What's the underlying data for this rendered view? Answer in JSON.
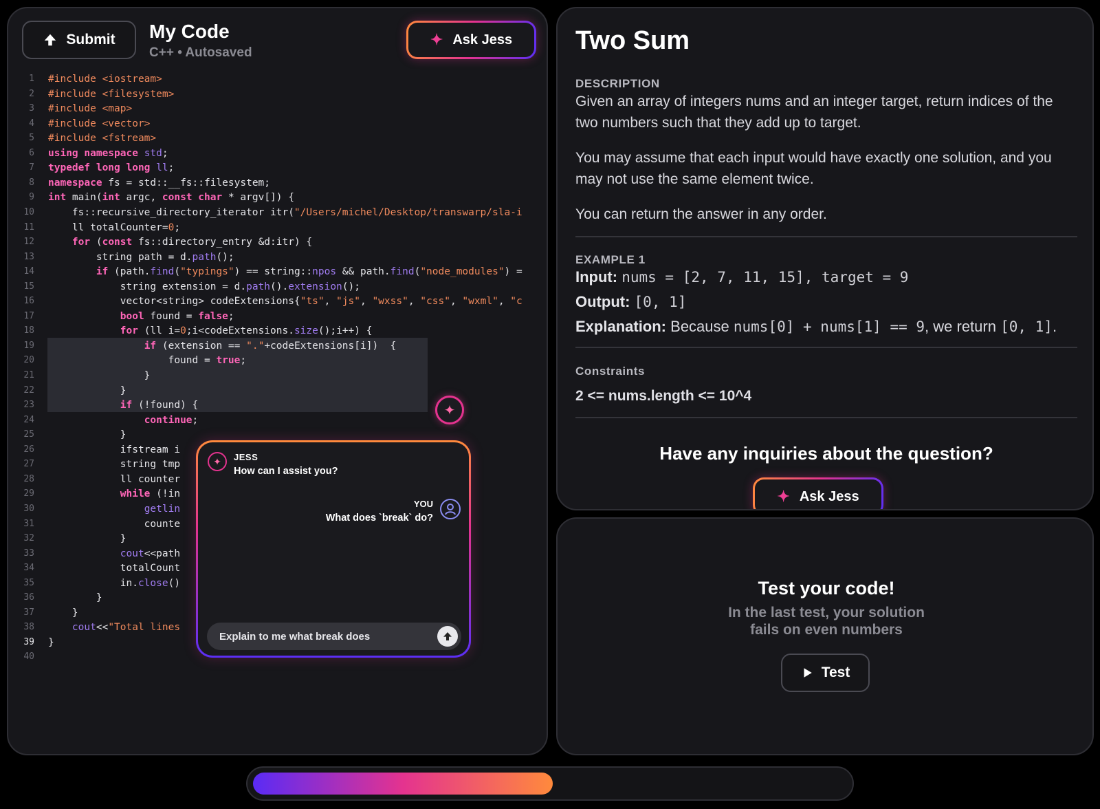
{
  "editor": {
    "submit_label": "Submit",
    "title": "My Code",
    "subtitle": "C++ • Autosaved",
    "ask_label": "Ask Jess",
    "active_line": 39,
    "lines": [
      [
        [
          "pp",
          "#include <iostream>"
        ]
      ],
      [
        [
          "pp",
          "#include <filesystem>"
        ]
      ],
      [
        [
          "pp",
          "#include <map>"
        ]
      ],
      [
        [
          "pp",
          "#include <vector>"
        ]
      ],
      [
        [
          "pp",
          "#include <fstream>"
        ]
      ],
      [
        [
          "kw",
          "using"
        ],
        [
          "op",
          " "
        ],
        [
          "kw",
          "namespace"
        ],
        [
          "op",
          " "
        ],
        [
          "id",
          "std"
        ],
        [
          "op",
          ";"
        ]
      ],
      [
        [
          "kw",
          "typedef"
        ],
        [
          "op",
          " "
        ],
        [
          "kw",
          "long long"
        ],
        [
          "op",
          " "
        ],
        [
          "id",
          "ll"
        ],
        [
          "op",
          ";"
        ]
      ],
      [
        [
          "kw",
          "namespace"
        ],
        [
          "op",
          " fs = std::__fs::filesystem;"
        ]
      ],
      [
        [
          "kw",
          "int"
        ],
        [
          "op",
          " main("
        ],
        [
          "kw",
          "int"
        ],
        [
          "op",
          " argc, "
        ],
        [
          "kw",
          "const char"
        ],
        [
          "op",
          " * argv[]) {"
        ]
      ],
      [
        [
          "op",
          "    fs::recursive_directory_iterator itr("
        ],
        [
          "st",
          "\"/Users/michel/Desktop/transwarp/sla-i"
        ]
      ],
      [
        [
          "op",
          "    ll totalCounter="
        ],
        [
          "nm",
          "0"
        ],
        [
          "op",
          ";"
        ]
      ],
      [
        [
          "op",
          "    "
        ],
        [
          "kw",
          "for"
        ],
        [
          "op",
          " ("
        ],
        [
          "kw",
          "const"
        ],
        [
          "op",
          " fs::directory_entry &d:itr) {"
        ]
      ],
      [
        [
          "op",
          "        string path = d."
        ],
        [
          "fn",
          "path"
        ],
        [
          "op",
          "();"
        ]
      ],
      [
        [
          "op",
          "        "
        ],
        [
          "kw",
          "if"
        ],
        [
          "op",
          " (path."
        ],
        [
          "fn",
          "find"
        ],
        [
          "op",
          "("
        ],
        [
          "st",
          "\"typings\""
        ],
        [
          "op",
          ") == string::"
        ],
        [
          "fn",
          "npos"
        ],
        [
          "op",
          " && path."
        ],
        [
          "fn",
          "find"
        ],
        [
          "op",
          "("
        ],
        [
          "st",
          "\"node_modules\""
        ],
        [
          "op",
          ") ="
        ]
      ],
      [
        [
          "op",
          "            string extension = d."
        ],
        [
          "fn",
          "path"
        ],
        [
          "op",
          "()."
        ],
        [
          "fn",
          "extension"
        ],
        [
          "op",
          "();"
        ]
      ],
      [
        [
          "op",
          "            vector<string> codeExtensions{"
        ],
        [
          "st",
          "\"ts\""
        ],
        [
          "op",
          ", "
        ],
        [
          "st",
          "\"js\""
        ],
        [
          "op",
          ", "
        ],
        [
          "st",
          "\"wxss\""
        ],
        [
          "op",
          ", "
        ],
        [
          "st",
          "\"css\""
        ],
        [
          "op",
          ", "
        ],
        [
          "st",
          "\"wxml\""
        ],
        [
          "op",
          ", "
        ],
        [
          "st",
          "\"c"
        ]
      ],
      [
        [
          "op",
          "            "
        ],
        [
          "kw",
          "bool"
        ],
        [
          "op",
          " found = "
        ],
        [
          "kw",
          "false"
        ],
        [
          "op",
          ";"
        ]
      ],
      [
        [
          "op",
          "            "
        ],
        [
          "kw",
          "for"
        ],
        [
          "op",
          " (ll i="
        ],
        [
          "nm",
          "0"
        ],
        [
          "op",
          ";i<codeExtensions."
        ],
        [
          "fn",
          "size"
        ],
        [
          "op",
          "();i++) {"
        ]
      ],
      [
        [
          "op",
          "                "
        ],
        [
          "kw",
          "if"
        ],
        [
          "op",
          " (extension == "
        ],
        [
          "st",
          "\".\""
        ],
        [
          "op",
          "+codeExtensions[i])  {"
        ]
      ],
      [
        [
          "op",
          "                    found = "
        ],
        [
          "kw",
          "true"
        ],
        [
          "op",
          ";"
        ]
      ],
      [
        [
          "op",
          "                }"
        ]
      ],
      [
        [
          "op",
          "            }"
        ]
      ],
      [
        [
          "op",
          "            "
        ],
        [
          "kw",
          "if"
        ],
        [
          "op",
          " (!found) {"
        ]
      ],
      [
        [
          "op",
          "                "
        ],
        [
          "kw",
          "continue"
        ],
        [
          "op",
          ";"
        ]
      ],
      [
        [
          "op",
          "            }"
        ]
      ],
      [
        [
          "op",
          "            ifstream i"
        ]
      ],
      [
        [
          "op",
          "            string tmp"
        ]
      ],
      [
        [
          "op",
          "            ll counter"
        ]
      ],
      [
        [
          "op",
          "            "
        ],
        [
          "kw",
          "while"
        ],
        [
          "op",
          " (!in"
        ]
      ],
      [
        [
          "op",
          "                "
        ],
        [
          "fn",
          "getlin"
        ]
      ],
      [
        [
          "op",
          "                counte"
        ]
      ],
      [
        [
          "op",
          "            }"
        ]
      ],
      [
        [
          "op",
          "            "
        ],
        [
          "fn",
          "cout"
        ],
        [
          "op",
          "<<path"
        ]
      ],
      [
        [
          "op",
          "            totalCount"
        ]
      ],
      [
        [
          "op",
          "            in."
        ],
        [
          "fn",
          "close"
        ],
        [
          "op",
          "()"
        ]
      ],
      [
        [
          "op",
          "        }"
        ]
      ],
      [
        [
          "op",
          "    }"
        ]
      ],
      [
        [
          "op",
          "    "
        ],
        [
          "fn",
          "cout"
        ],
        [
          "op",
          "<<"
        ],
        [
          "st",
          "\"Total lines"
        ]
      ],
      [
        [
          "op",
          "}"
        ]
      ],
      [
        [
          "op",
          ""
        ]
      ]
    ]
  },
  "chat": {
    "assistant_name": "JESS",
    "assistant_msg": "How can I assist you?",
    "user_name": "YOU",
    "user_msg": "What does `break` do?",
    "input_value": "Explain to me what break does"
  },
  "problem": {
    "title": "Two Sum",
    "description_label": "DESCRIPTION",
    "para1": "Given an array of integers nums and an integer target, return indices of the two numbers such that they add up to target.",
    "para2": "You may assume that each input would have exactly one solution, and you may not use the same element twice.",
    "para3": "You can return the answer in any order.",
    "example_label": "EXAMPLE 1",
    "input_label": "Input:",
    "input_value": "nums = [2, 7, 11, 15], target = 9",
    "output_label": "Output:",
    "output_value": "[0, 1]",
    "explanation_label": "Explanation:",
    "explanation_pre": "Because ",
    "explanation_code1": "nums[0] + nums[1] == 9",
    "explanation_mid": ", we return ",
    "explanation_code2": "[0, 1]",
    "explanation_end": ".",
    "constraints_label": "Constraints",
    "constraint_1": "2 <= nums.length <= 10^4",
    "inquiry": "Have any inquiries about the question?",
    "ask_label": "Ask Jess"
  },
  "test": {
    "title": "Test your code!",
    "subtitle_1": "In the last test, your solution",
    "subtitle_2": "fails on even numbers",
    "button_label": "Test"
  },
  "progress": {
    "fraction": 0.505
  },
  "colors": {
    "accent_pink": "#e4338f",
    "accent_orange": "#ff8a3c",
    "accent_purple": "#5b2ff5",
    "keyword": "#ff66b8",
    "string": "#f08a5d",
    "function": "#a07cf0"
  }
}
